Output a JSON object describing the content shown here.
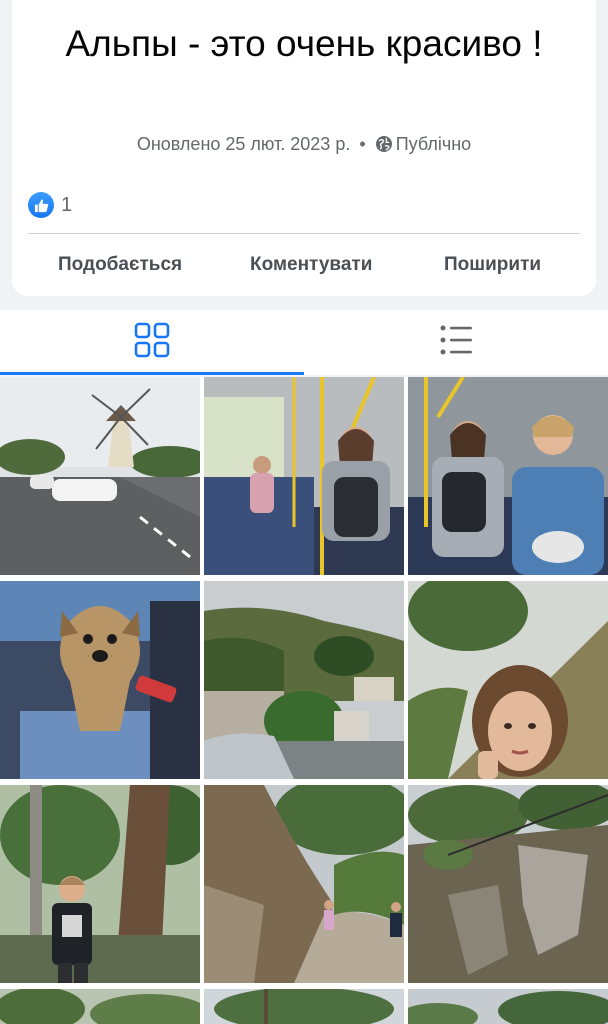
{
  "post": {
    "title": "Альпы - это очень красиво !",
    "updated": "Оновлено 25 лют. 2023 р.",
    "separator": "•",
    "privacy": "Публічно",
    "reaction_count": "1"
  },
  "actions": {
    "like": "Подобається",
    "comment": "Коментувати",
    "share": "Поширити"
  },
  "tabs": {
    "active": "grid",
    "items": [
      "grid-view",
      "list-view"
    ]
  },
  "photos": [
    {
      "subject": "windmill-street"
    },
    {
      "subject": "bus-interior-girls"
    },
    {
      "subject": "bus-interior-women"
    },
    {
      "subject": "yorkshire-terrier"
    },
    {
      "subject": "hillside-village-car"
    },
    {
      "subject": "selfie-woman-hillside"
    },
    {
      "subject": "boy-by-tree"
    },
    {
      "subject": "hiking-path-kids"
    },
    {
      "subject": "rocky-slope-pines"
    },
    {
      "subject": "trees-partial-1"
    },
    {
      "subject": "trees-partial-2"
    },
    {
      "subject": "trees-partial-3"
    }
  ],
  "colors": {
    "accent": "#1877f2",
    "text_secondary": "#65676b",
    "background": "#f0f2f5"
  }
}
